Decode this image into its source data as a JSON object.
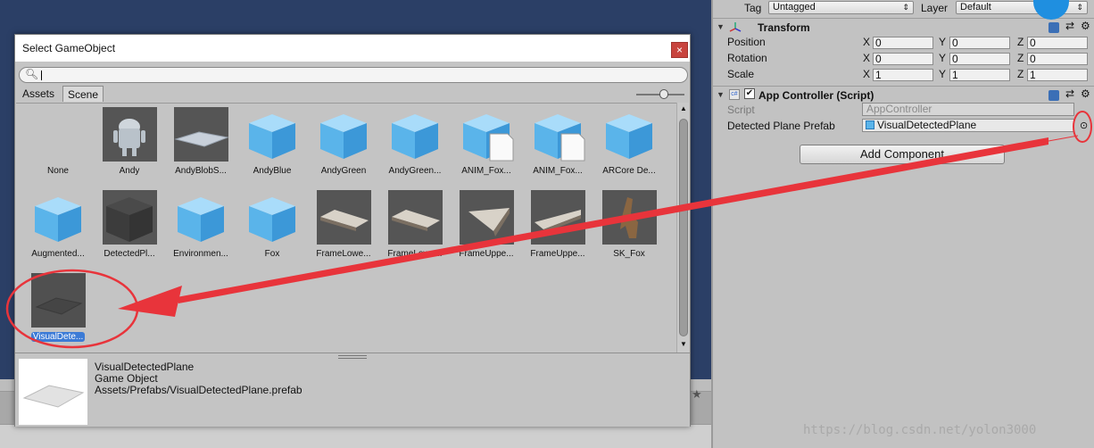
{
  "dialog": {
    "title": "Select GameObject",
    "close_label": "×",
    "search_placeholder": "",
    "tabs": [
      "Assets",
      "Scene"
    ],
    "active_tab": "Scene",
    "assets": [
      {
        "label": "None",
        "kind": "none"
      },
      {
        "label": "Andy",
        "kind": "android"
      },
      {
        "label": "AndyBlobS...",
        "kind": "plane"
      },
      {
        "label": "AndyBlue",
        "kind": "cube"
      },
      {
        "label": "AndyGreen",
        "kind": "cube"
      },
      {
        "label": "AndyGreen...",
        "kind": "cube"
      },
      {
        "label": "ANIM_Fox...",
        "kind": "cube-doc"
      },
      {
        "label": "ANIM_Fox...",
        "kind": "cube-doc"
      },
      {
        "label": "ARCore De...",
        "kind": "cube"
      },
      {
        "label": "Augmented...",
        "kind": "cube"
      },
      {
        "label": "DetectedPl...",
        "kind": "darkcube"
      },
      {
        "label": "Environmen...",
        "kind": "cube"
      },
      {
        "label": "Fox",
        "kind": "cube"
      },
      {
        "label": "FrameLowe...",
        "kind": "frame"
      },
      {
        "label": "FrameLowe...",
        "kind": "frame"
      },
      {
        "label": "FrameUppe...",
        "kind": "frame2"
      },
      {
        "label": "FrameUppe...",
        "kind": "frame3"
      },
      {
        "label": "SK_Fox",
        "kind": "fox"
      },
      {
        "label": "VisualDete...",
        "kind": "darkplane",
        "selected": true
      }
    ],
    "preview": {
      "name": "VisualDetectedPlane",
      "type": "Game Object",
      "path": "Assets/Prefabs/VisualDetectedPlane.prefab"
    }
  },
  "inspector": {
    "tag_label": "Tag",
    "tag_value": "Untagged",
    "layer_label": "Layer",
    "layer_value": "Default",
    "transform": {
      "title": "Transform",
      "rows": [
        {
          "label": "Position",
          "x": "0",
          "y": "0",
          "z": "0"
        },
        {
          "label": "Rotation",
          "x": "0",
          "y": "0",
          "z": "0"
        },
        {
          "label": "Scale",
          "x": "1",
          "y": "1",
          "z": "1"
        }
      ],
      "axes": [
        "X",
        "Y",
        "Z"
      ]
    },
    "app_controller": {
      "title": "App Controller (Script)",
      "script_label": "Script",
      "script_value": "AppController",
      "prefab_label": "Detected Plane Prefab",
      "prefab_value": "VisualDetectedPlane"
    },
    "add_component_label": "Add Component"
  },
  "watermark": "https://blog.csdn.net/yolon3000",
  "colors": {
    "selection": "#3c7bd6",
    "annotation_red": "#e8343b",
    "cube_blue": "#5ab4ea"
  }
}
